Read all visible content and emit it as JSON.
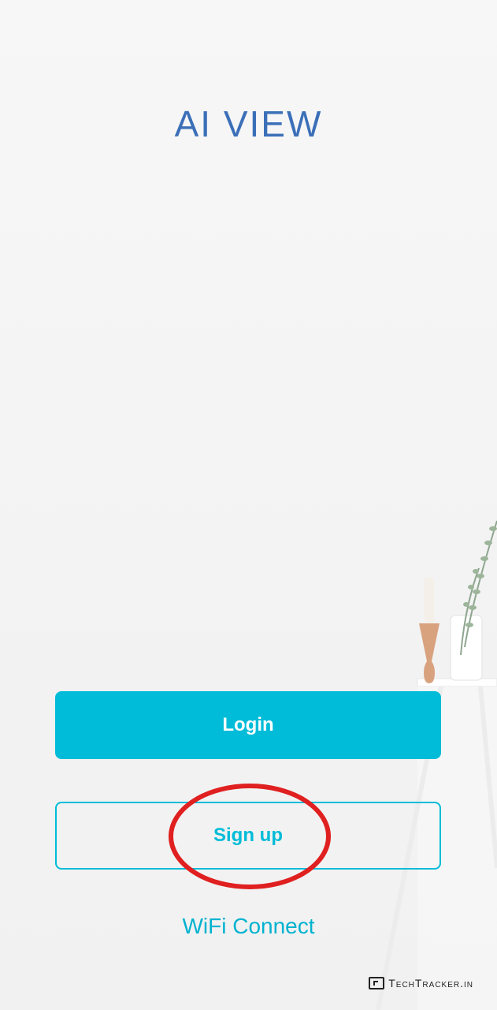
{
  "app": {
    "title": "AI VIEW"
  },
  "actions": {
    "login_label": "Login",
    "signup_label": "Sign up",
    "wifi_label": "WiFi Connect"
  },
  "watermark": {
    "text": "TechTracker.in",
    "icon": "cursor-window-icon"
  },
  "colors": {
    "accent": "#00bcd8",
    "title": "#3b6fb8",
    "annotation": "#e02020"
  }
}
